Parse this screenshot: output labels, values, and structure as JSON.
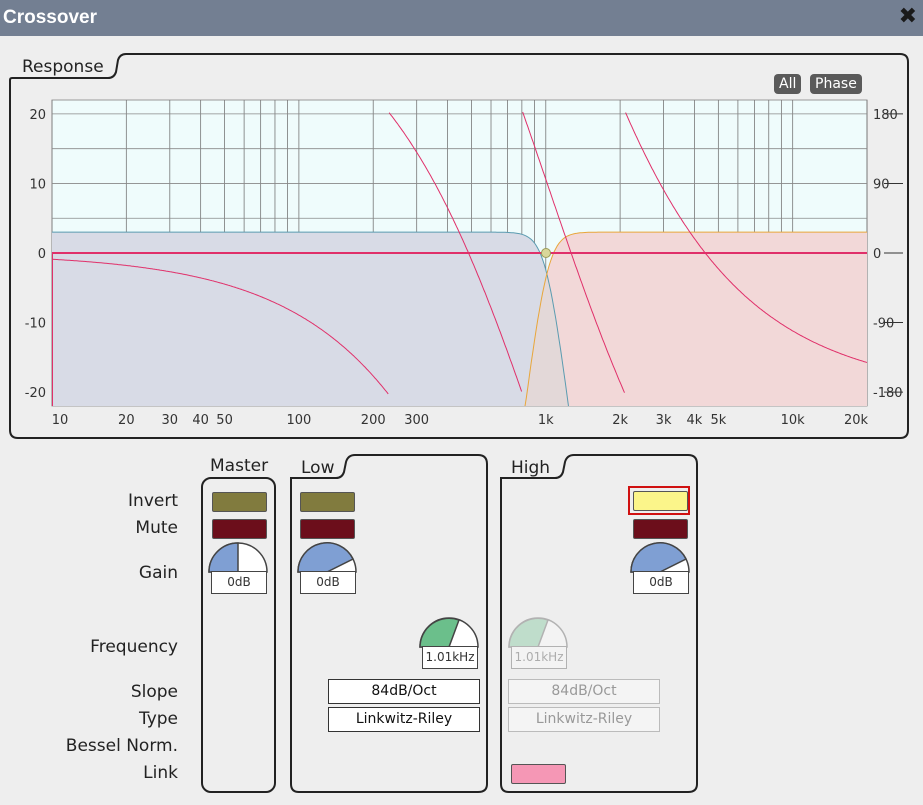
{
  "window": {
    "title": "Crossover",
    "close_icon": "close-icon"
  },
  "response": {
    "label": "Response",
    "all_button": "All",
    "phase_button": "Phase",
    "y_ticks_left": [
      "20",
      "10",
      "0",
      "-10",
      "-20"
    ],
    "y_ticks_right": [
      "180",
      "90",
      "0",
      "-90",
      "-180"
    ],
    "x_ticks": [
      "10",
      "20",
      "30",
      "40",
      "50",
      "100",
      "200",
      "300",
      "1k",
      "2k",
      "3k",
      "4k",
      "5k",
      "10k",
      "20k"
    ]
  },
  "sections": {
    "master": "Master",
    "low": "Low",
    "high": "High"
  },
  "rows": {
    "invert": "Invert",
    "mute": "Mute",
    "gain": "Gain",
    "frequency": "Frequency",
    "slope": "Slope",
    "type": "Type",
    "bessel_norm": "Bessel Norm.",
    "link": "Link"
  },
  "master": {
    "gain": "0dB"
  },
  "low": {
    "gain": "0dB",
    "frequency": "1.01kHz",
    "slope": "84dB/Oct",
    "type": "Linkwitz-Riley"
  },
  "high": {
    "gain": "0dB",
    "frequency": "1.01kHz",
    "slope": "84dB/Oct",
    "type": "Linkwitz-Riley"
  },
  "colors": {
    "titlebar": "#737f92",
    "invert_off": "#817b3e",
    "mute_off": "#6c0e1b",
    "invert_on": "#fbf58a",
    "link": "#f597b5",
    "knob_gain": "#7f9fd3",
    "knob_freq": "#6bbf8b",
    "phase_line": "#e0306a",
    "low_fill": "#d8dbe6",
    "high_fill": "#f2d8d8",
    "plot_bg": "#effcfc"
  }
}
